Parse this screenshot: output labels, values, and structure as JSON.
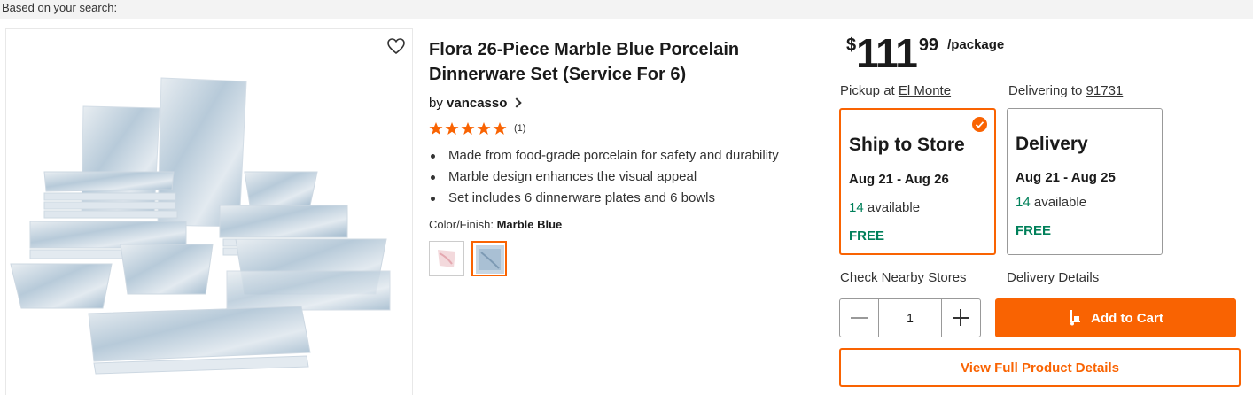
{
  "banner": {
    "text": "Based on your search:"
  },
  "product": {
    "title_line1": "Flora 26-Piece Marble Blue Porcelain",
    "title_line2": "Dinnerware Set (Service For 6)",
    "by": "by",
    "brand": "vancasso",
    "rating": {
      "stars": 5,
      "count": "(1)"
    },
    "bullets": [
      "Made from food-grade porcelain for safety and durability",
      "Marble design enhances the visual appeal",
      "Set includes 6 dinnerware plates and 6 bowls"
    ],
    "color_label": "Color/Finish:",
    "color_value": "Marble Blue",
    "swatches": [
      {
        "name": "pink-marble",
        "color": "#f3d9dc",
        "selected": false
      },
      {
        "name": "marble-blue",
        "color": "#8fb0cc",
        "selected": true
      }
    ]
  },
  "price": {
    "currency": "$",
    "dollars": "111",
    "cents": "99",
    "unit": "/package"
  },
  "fulfillment": {
    "pickup_label": "Pickup at",
    "pickup_store": "El Monte",
    "delivering_label": "Delivering to",
    "zip": "91731",
    "options": [
      {
        "title": "Ship to Store",
        "dates": "Aug 21 - Aug 26",
        "count": "14",
        "avail_label": "available",
        "cost": "FREE",
        "selected": true
      },
      {
        "title": "Delivery",
        "dates": "Aug 21 - Aug 25",
        "count": "14",
        "avail_label": "available",
        "cost": "FREE",
        "selected": false
      }
    ],
    "check_stores": "Check Nearby Stores",
    "delivery_details": "Delivery Details"
  },
  "cart": {
    "quantity": "1",
    "add_label": "Add to Cart",
    "view_details": "View Full Product Details"
  },
  "colors": {
    "accent": "#f96302",
    "green": "#00805a",
    "star": "#f96302"
  },
  "icons": [
    "heart-icon",
    "chevron-right-icon",
    "star-icon",
    "check-circle-icon",
    "minus-icon",
    "plus-icon",
    "cart-dolly-icon"
  ]
}
